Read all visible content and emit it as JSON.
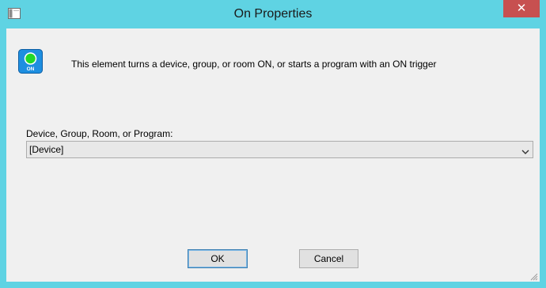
{
  "window": {
    "title": "On Properties",
    "close_label": "✕"
  },
  "icons": {
    "system_menu": "app-window-icon",
    "info": "on-trigger-icon",
    "info_text": "ON",
    "dropdown": "chevron-down-icon",
    "resize": "resize-grip-icon"
  },
  "description": "This element turns a device, group, or room ON, or starts a program with an ON trigger",
  "target": {
    "label": "Device, Group, Room, or Program:",
    "selected": "[Device]"
  },
  "buttons": {
    "ok": "OK",
    "cancel": "Cancel"
  },
  "colors": {
    "titlebar": "#5fd3e3",
    "close": "#c75050",
    "icon_bg": "#1e8fe0",
    "icon_led": "#22d82a"
  }
}
